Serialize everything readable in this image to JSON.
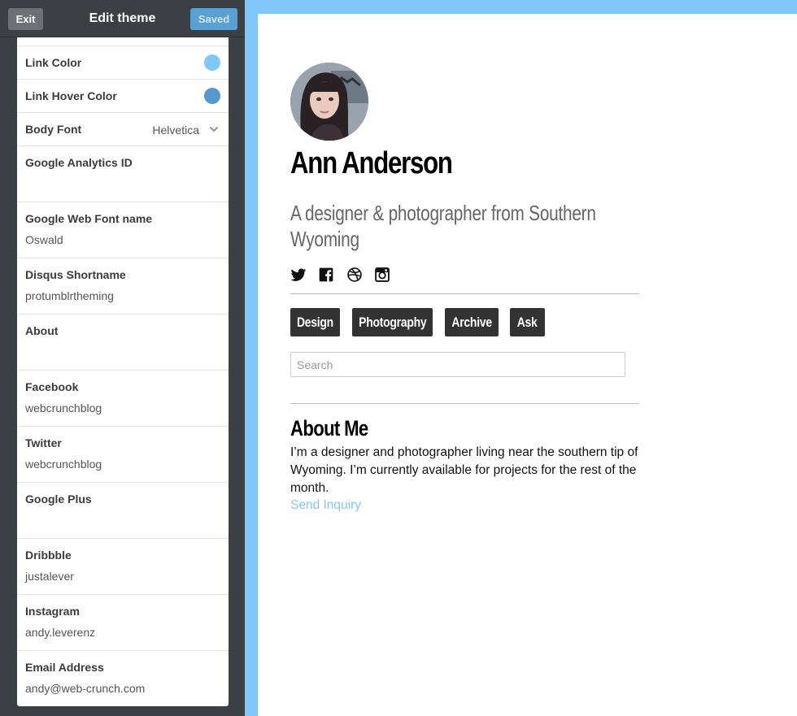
{
  "topbar": {
    "exit_label": "Exit",
    "title": "Edit theme",
    "saved_label": "Saved"
  },
  "settings": {
    "link_color": {
      "label": "Link Color",
      "color": "#80c8fa"
    },
    "link_hover_color": {
      "label": "Link Hover Color",
      "color": "#5599cc"
    },
    "body_font": {
      "label": "Body Font",
      "value": "Helvetica"
    },
    "fields": [
      {
        "label": "Google Analytics ID",
        "value": ""
      },
      {
        "label": "Google Web Font name",
        "value": "Oswald"
      },
      {
        "label": "Disqus Shortname",
        "value": "protumblrtheming"
      },
      {
        "label": "About",
        "value": ""
      },
      {
        "label": "Facebook",
        "value": "webcrunchblog"
      },
      {
        "label": "Twitter",
        "value": "webcrunchblog"
      },
      {
        "label": "Google Plus",
        "value": ""
      },
      {
        "label": "Dribbble",
        "value": "justalever"
      },
      {
        "label": "Instagram",
        "value": "andy.leverenz"
      },
      {
        "label": "Email Address",
        "value": "andy@web-crunch.com"
      }
    ]
  },
  "preview": {
    "frame_color": "#80c8fa",
    "name": "Ann Anderson",
    "tagline": "A designer & photographer from Southern Wyoming",
    "social_icons": [
      "twitter-icon",
      "facebook-icon",
      "dribbble-icon",
      "instagram-icon"
    ],
    "nav": [
      "Design",
      "Photography",
      "Archive",
      "Ask"
    ],
    "search_placeholder": "Search",
    "about_title": "About Me",
    "about_body": "I’m a designer and photographer living near the southern tip of Wyoming. I’m currently available for projects for the rest of the month.",
    "inquiry_label": "Send Inquiry"
  }
}
